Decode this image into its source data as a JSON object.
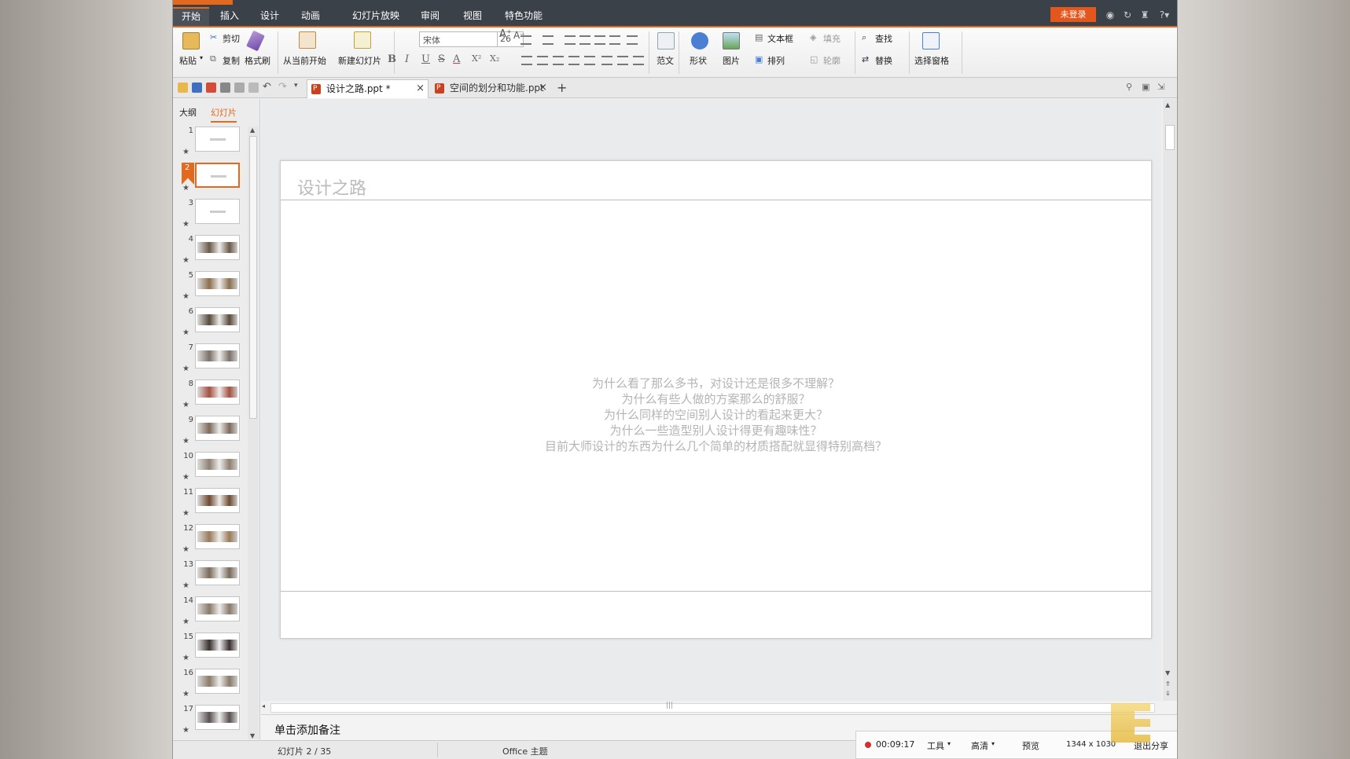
{
  "menu": {
    "tabs": [
      "开始",
      "插入",
      "设计",
      "动画",
      "幻灯片放映",
      "审阅",
      "视图",
      "特色功能"
    ],
    "login": "未登录"
  },
  "ribbon": {
    "paste": "粘贴",
    "cut": "剪切",
    "copy": "复制",
    "format_painter": "格式刷",
    "from_current": "从当前开始",
    "new_slide": "新建幻灯片",
    "font_name": "宋体",
    "font_size": "26",
    "template": "范文",
    "shape": "形状",
    "picture": "图片",
    "textbox": "文本框",
    "arrange": "排列",
    "fill": "填充",
    "outline": "轮廓",
    "find": "查找",
    "replace": "替换",
    "selection_pane": "选择窗格",
    "bold": "B",
    "italic": "I",
    "underline": "U",
    "strike": "S",
    "fontcolor": "A",
    "superscript": "X²",
    "subscript": "X₂",
    "grow": "A⁺",
    "shrink": "A⁻"
  },
  "tabs": {
    "doc1": "设计之路.ppt *",
    "doc2": "空间的划分和功能.ppt *",
    "add": "+"
  },
  "leftpane": {
    "outline": "大纲",
    "slides": "幻灯片"
  },
  "thumbnails": [
    "1",
    "2",
    "3",
    "4",
    "5",
    "6",
    "7",
    "8",
    "9",
    "10",
    "11",
    "12",
    "13",
    "14",
    "15",
    "16",
    "17"
  ],
  "slide": {
    "title": "设计之路",
    "lines": [
      "为什么看了那么多书，对设计还是很多不理解？",
      "为什么有些人做的方案那么的舒服？",
      "为什么同样的空间别人设计的看起来更大？",
      "为什么一些造型别人设计得更有趣味性？",
      "目前大师设计的东西为什么几个简单的材质搭配就显得特别高档？"
    ]
  },
  "notes": "单击添加备注",
  "status": {
    "slide_count": "幻灯片 2 / 35",
    "theme": "Office 主题"
  },
  "recorder": {
    "time": "00:09:17",
    "tools": "工具",
    "quality": "高清",
    "preview": "预览",
    "size": "1344 x 1030",
    "exit": "退出分享"
  },
  "colors": {
    "accent": "#e2691d",
    "menubar": "#3a4149",
    "login": "#e4571c"
  }
}
